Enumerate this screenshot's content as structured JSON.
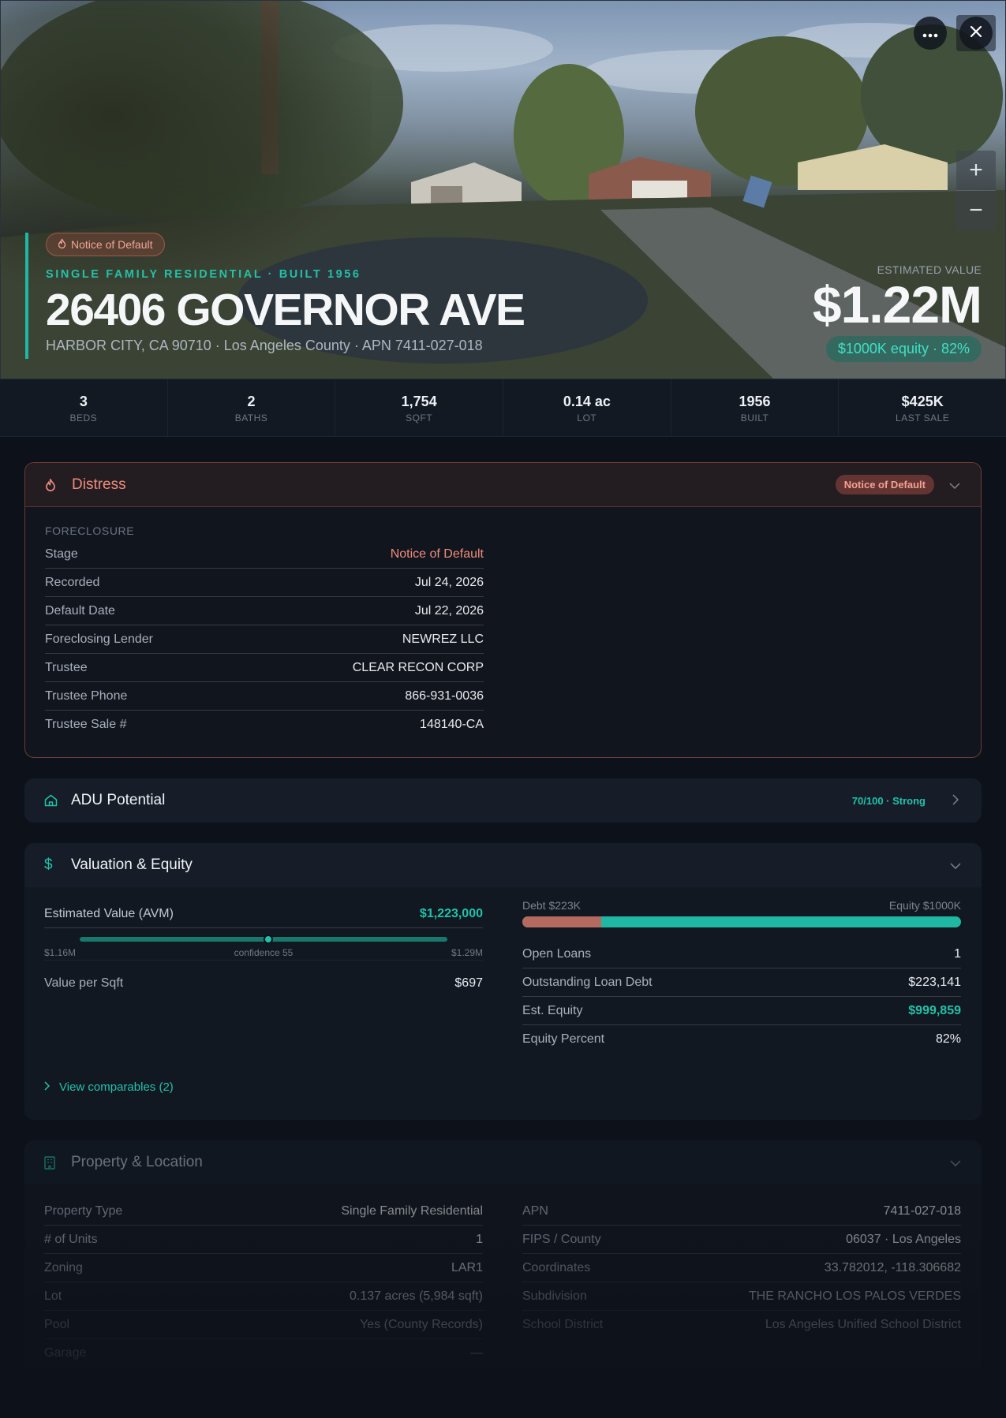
{
  "hero": {
    "badge": "Notice of Default",
    "subtitle": "SINGLE FAMILY RESIDENTIAL · BUILT 1956",
    "address": "26406 GOVERNOR AVE",
    "location": "HARBOR CITY, CA 90710 · Los Angeles County · APN 7411-027-018",
    "estimated_value_label": "ESTIMATED VALUE",
    "estimated_value": "$1.22M",
    "equity_pill": "$1000K equity · 82%",
    "more_icon": "ellipsis-icon",
    "close_icon": "close-icon",
    "zoom_in": "+",
    "zoom_out": "−"
  },
  "stats": [
    {
      "value": "3",
      "label": "BEDS"
    },
    {
      "value": "2",
      "label": "BATHS"
    },
    {
      "value": "1,754",
      "label": "SQFT"
    },
    {
      "value": "0.14 ac",
      "label": "LOT"
    },
    {
      "value": "1956",
      "label": "BUILT"
    },
    {
      "value": "$425K",
      "label": "LAST SALE"
    }
  ],
  "distress": {
    "title": "Distress",
    "badge": "Notice of Default",
    "section_label": "FORECLOSURE",
    "rows": [
      {
        "k": "Stage",
        "v": "Notice of Default"
      },
      {
        "k": "Recorded",
        "v": "Jul 24, 2026"
      },
      {
        "k": "Default Date",
        "v": "Jul 22, 2026"
      },
      {
        "k": "Foreclosing Lender",
        "v": "NEWREZ LLC"
      },
      {
        "k": "Trustee",
        "v": "CLEAR RECON CORP"
      },
      {
        "k": "Trustee Phone",
        "v": "866-931-0036"
      },
      {
        "k": "Trustee Sale #",
        "v": "148140-CA"
      }
    ]
  },
  "adu": {
    "title": "ADU Potential",
    "score": "70/100 · Strong"
  },
  "valuation": {
    "title": "Valuation & Equity",
    "avm_label": "Estimated Value (AVM)",
    "avm_value": "$1,223,000",
    "range_low": "$1.16M",
    "range_confidence": "confidence 55",
    "range_high": "$1.29M",
    "value_per_sqft_label": "Value per Sqft",
    "value_per_sqft": "$697",
    "debt_label": "Debt $223K",
    "equity_label": "Equity $1000K",
    "debt_fraction": 0.18,
    "rows": [
      {
        "k": "Open Loans",
        "v": "1"
      },
      {
        "k": "Outstanding Loan Debt",
        "v": "$223,141"
      },
      {
        "k": "Est. Equity",
        "v": "$999,859"
      },
      {
        "k": "Equity Percent",
        "v": "82%"
      }
    ],
    "view_comparables": "View comparables (2)"
  },
  "property": {
    "title": "Property & Location",
    "left": [
      {
        "k": "Property Type",
        "v": "Single Family Residential"
      },
      {
        "k": "# of Units",
        "v": "1"
      },
      {
        "k": "Zoning",
        "v": "LAR1"
      },
      {
        "k": "Lot",
        "v": "0.137 acres (5,984 sqft)"
      },
      {
        "k": "Pool",
        "v": "Yes (County Records)"
      },
      {
        "k": "Garage",
        "v": "—"
      }
    ],
    "right": [
      {
        "k": "APN",
        "v": "7411-027-018"
      },
      {
        "k": "FIPS / County",
        "v": "06037 · Los Angeles"
      },
      {
        "k": "Coordinates",
        "v": "33.782012, -118.306682"
      },
      {
        "k": "Subdivision",
        "v": "THE RANCHO LOS PALOS VERDES"
      },
      {
        "k": "School District",
        "v": "Los Angeles Unified School District"
      }
    ]
  },
  "colors": {
    "accent": "#22c2a9",
    "distress": "#ef8d7d",
    "background": "#0d1119"
  }
}
